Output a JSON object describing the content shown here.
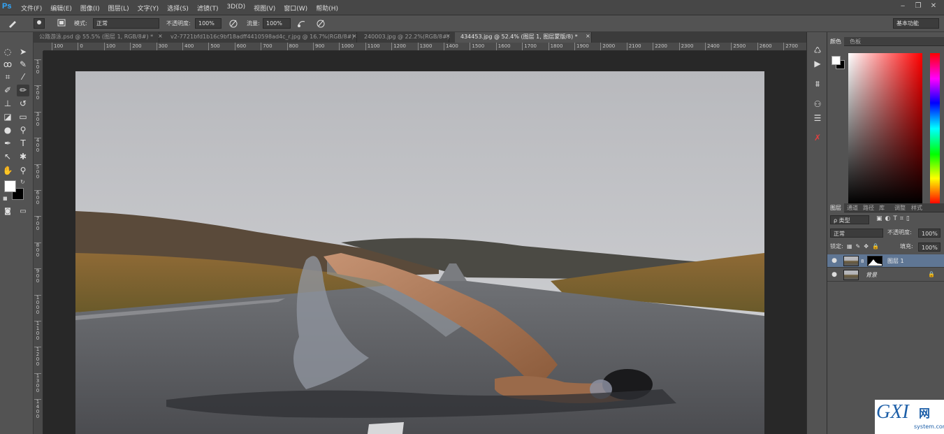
{
  "app": {
    "logo": "Ps"
  },
  "menu": [
    "文件(F)",
    "编辑(E)",
    "图像(I)",
    "图层(L)",
    "文字(Y)",
    "选择(S)",
    "滤镜(T)",
    "3D(D)",
    "视图(V)",
    "窗口(W)",
    "帮助(H)"
  ],
  "window_controls": {
    "minimize": "‒",
    "restore": "❐",
    "close": "✕"
  },
  "options": {
    "mode_label": "模式:",
    "mode_value": "正常",
    "opacity_label": "不透明度:",
    "opacity_value": "100%",
    "flow_label": "流量:",
    "flow_value": "100%",
    "workspace": "基本功能"
  },
  "tabs": [
    {
      "label": "公路游泳.psd @ 55.5% (图层 1, RGB/8#) *"
    },
    {
      "label": "v2-7721bfd1b16c9bf18adff4410598ad4c_r.jpg @ 16.7%(RGB/8#)"
    },
    {
      "label": "240003.jpg @ 22.2%(RGB/8#)"
    },
    {
      "label": "434453.jpg @ 52.4% (图层 1, 图层蒙版/8) *"
    }
  ],
  "ruler_top": [
    "100",
    "0",
    "100",
    "200",
    "300",
    "400",
    "500",
    "600",
    "700",
    "800",
    "900",
    "1000",
    "1100",
    "1200",
    "1300",
    "1400",
    "1500",
    "1600",
    "1700",
    "1800",
    "1900",
    "2000",
    "2100",
    "2200",
    "2300",
    "2400",
    "2500",
    "2600",
    "2700"
  ],
  "ruler_left": [
    "1\n0\n0",
    "2\n0\n0",
    "3\n0\n0",
    "4\n0\n0",
    "5\n0\n0",
    "6\n0\n0",
    "7\n0\n0",
    "8\n0\n0",
    "9\n0\n0",
    "1\n0\n0\n0",
    "1\n1\n0\n0",
    "1\n2\n0\n0",
    "1\n3\n0\n0",
    "1\n4\n0\n0"
  ],
  "color_panel": {
    "tabs": [
      "颜色",
      "色板"
    ]
  },
  "layers_panel": {
    "tabs": [
      "图层",
      "通道",
      "路径",
      "库",
      "调整",
      "样式"
    ],
    "filter_type": "ρ 类型",
    "blend_mode": "正常",
    "opacity_label": "不透明度:",
    "opacity_value": "100%",
    "lock_label": "锁定:",
    "fill_label": "填充:",
    "fill_value": "100%",
    "layers": [
      {
        "name": "图层 1",
        "selected": true
      },
      {
        "name": "背景",
        "selected": false
      }
    ]
  },
  "watermark": {
    "logo": "GXI",
    "net": "网",
    "site": "system.com"
  }
}
